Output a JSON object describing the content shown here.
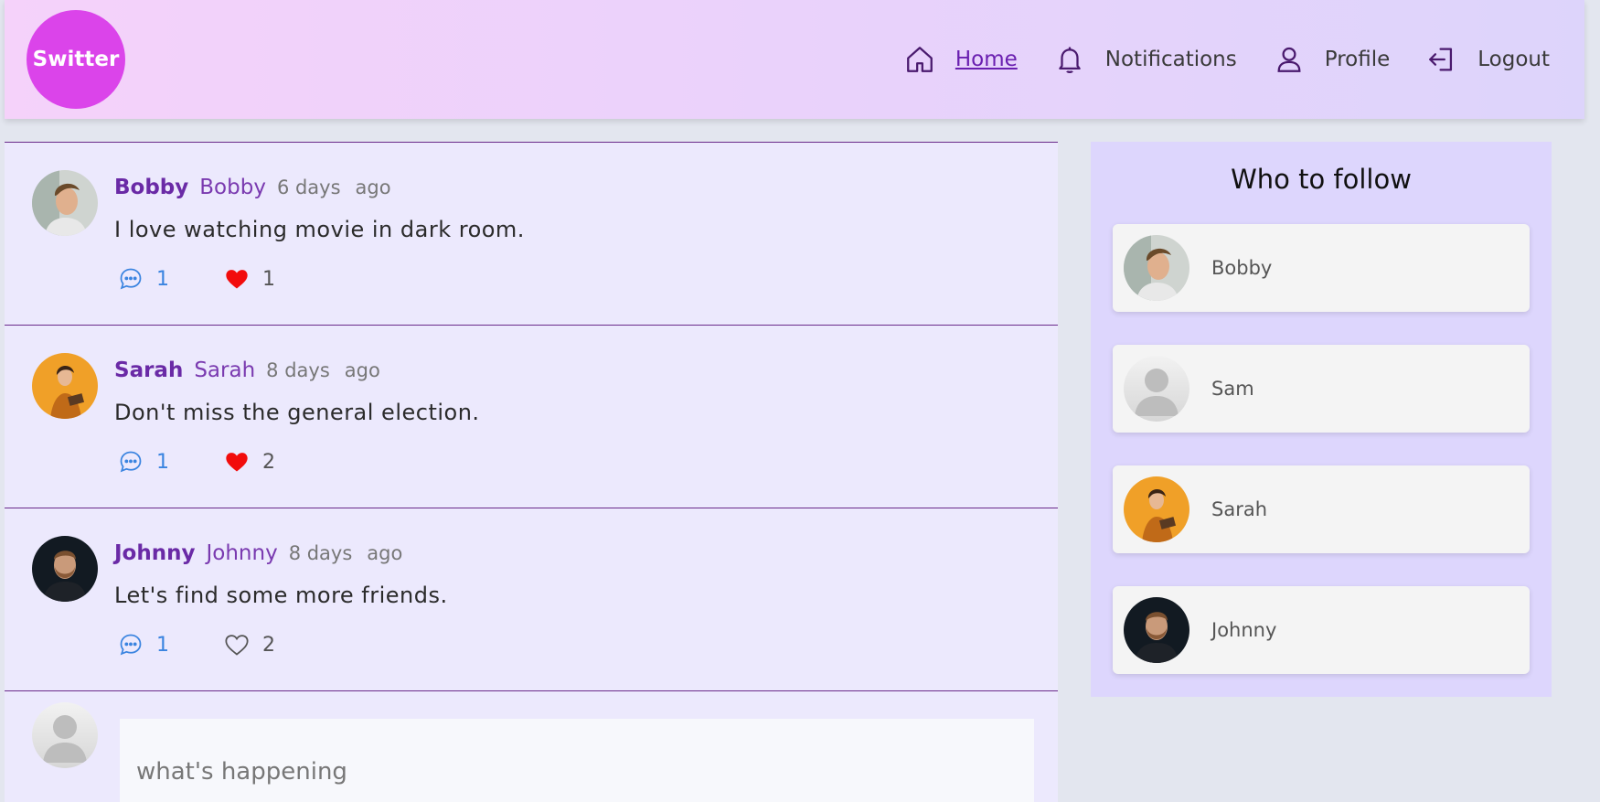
{
  "app": {
    "logo_text": "Switter"
  },
  "nav": {
    "items": [
      {
        "label": "Home",
        "icon": "home-icon",
        "active": true
      },
      {
        "label": "Notifications",
        "icon": "bell-icon",
        "active": false
      },
      {
        "label": "Profile",
        "icon": "user-icon",
        "active": false
      },
      {
        "label": "Logout",
        "icon": "logout-icon",
        "active": false
      }
    ]
  },
  "feed": {
    "posts": [
      {
        "name": "Bobby",
        "handle": "Bobby",
        "time": "6 days",
        "ago": "ago",
        "text": "I love watching movie in dark room.",
        "comments": "1",
        "likes": "1",
        "liked": true
      },
      {
        "name": "Sarah",
        "handle": "Sarah",
        "time": "8 days",
        "ago": "ago",
        "text": "Don't miss the general election.",
        "comments": "1",
        "likes": "2",
        "liked": true
      },
      {
        "name": "Johnny",
        "handle": "Johnny",
        "time": "8 days",
        "ago": "ago",
        "text": "Let's find some more friends.",
        "comments": "1",
        "likes": "2",
        "liked": false
      }
    ],
    "composer": {
      "placeholder": "what's happening"
    }
  },
  "sidebar": {
    "title": "Who to follow",
    "users": [
      {
        "name": "Bobby"
      },
      {
        "name": "Sam"
      },
      {
        "name": "Sarah"
      },
      {
        "name": "Johnny"
      }
    ]
  },
  "colors": {
    "accent": "#6a2aa6",
    "logo_bg": "#db44ea",
    "like_red": "#f20c0c",
    "comment_blue": "#3a84e0"
  }
}
